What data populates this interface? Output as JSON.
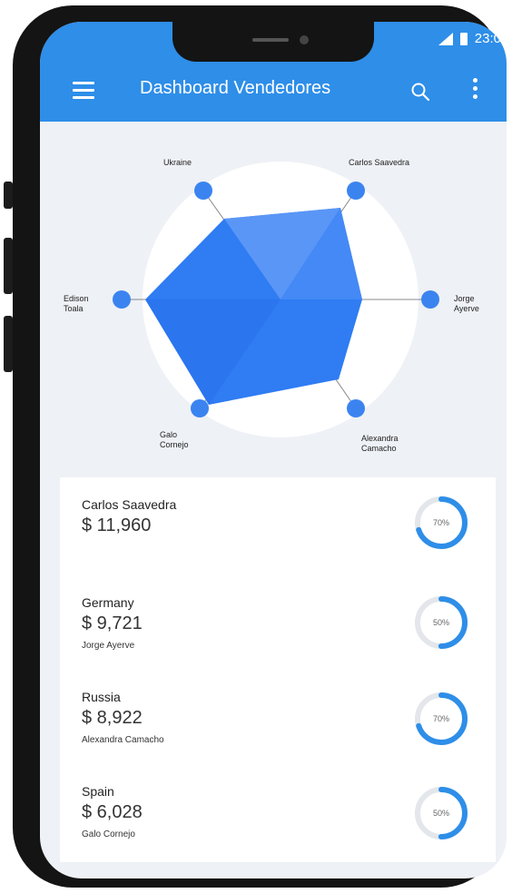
{
  "status": {
    "time": "23:0"
  },
  "appbar": {
    "title": "Dashboard Vendedores"
  },
  "icons": {
    "menu": "menu-icon",
    "search": "search-icon",
    "more": "more-vert-icon"
  },
  "colors": {
    "primary": "#2e8ee8",
    "radar_fill": "#2f7cf3",
    "ring": "#2e8ee8"
  },
  "radar_labels": {
    "ukraine": "Ukraine",
    "carlos": "Carlos Saavedra",
    "jorge_1": "Jorge",
    "jorge_2": "Ayerve",
    "alexandra_1": "Alexandra",
    "alexandra_2": "Camacho",
    "galo_1": "Galo",
    "galo_2": "Cornejo",
    "edison_1": "Edison",
    "edison_2": "Toala"
  },
  "sales": [
    {
      "name": "Carlos Saavedra",
      "amount": "$ 11,960",
      "sub": "",
      "percent_label": "70%",
      "percent": 0.7
    },
    {
      "name": "Germany",
      "amount": "$ 9,721",
      "sub": "Jorge Ayerve",
      "percent_label": "50%",
      "percent": 0.5
    },
    {
      "name": "Russia",
      "amount": "$ 8,922",
      "sub": "Alexandra Camacho",
      "percent_label": "70%",
      "percent": 0.7
    },
    {
      "name": "Spain",
      "amount": "$ 6,028",
      "sub": "Galo Cornejo",
      "percent_label": "50%",
      "percent": 0.5
    }
  ]
}
